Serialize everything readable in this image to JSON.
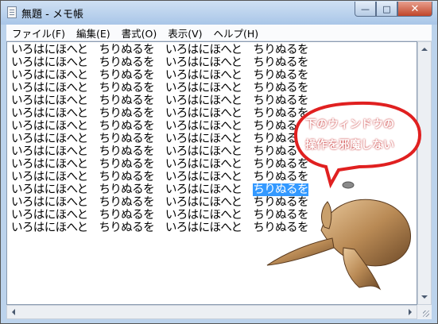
{
  "window": {
    "title": "無題 - メモ帳",
    "minimize_glyph": "—",
    "maximize_glyph": "□",
    "close_glyph": "✕",
    "icon": "notepad-icon"
  },
  "menu": {
    "items": [
      {
        "label": "ファイル(F)"
      },
      {
        "label": "編集(E)"
      },
      {
        "label": "書式(O)"
      },
      {
        "label": "表示(V)"
      },
      {
        "label": "ヘルプ(H)"
      }
    ]
  },
  "editor": {
    "lines": [
      "いろはにほへと　ちりぬるを　いろはにほへと　ちりぬるを",
      "いろはにほへと　ちりぬるを　いろはにほへと　ちりぬるを",
      "いろはにほへと　ちりぬるを　いろはにほへと　ちりぬるを",
      "いろはにほへと　ちりぬるを　いろはにほへと　ちりぬるを",
      "いろはにほへと　ちりぬるを　いろはにほへと　ちりぬるを",
      "いろはにほへと　ちりぬるを　いろはにほへと　ちりぬるを",
      "いろはにほへと　ちりぬるを　いろはにほへと　ちりぬるを",
      "いろはにほへと　ちりぬるを　いろはにほへと　ちりぬるを",
      "いろはにほへと　ちりぬるを　いろはにほへと　ちりぬるを",
      "いろはにほへと　ちりぬるを　いろはにほへと　ちりぬるを",
      "いろはにほへと　ちりぬるを　いろはにほへと　ちりぬるを",
      "いろはにほへと　ちりぬるを　いろはにほへと　ちりぬるを",
      "いろはにほへと　ちりぬるを　いろはにほへと　ちりぬるを",
      "いろはにほへと　ちりぬるを　いろはにほへと　ちりぬるを",
      "いろはにほへと　ちりぬるを　いろはにほへと　ちりぬるを"
    ],
    "selected_line_prefix": "いろはにほへと　ちりぬるを　いろはにほへと　",
    "selected_text": "ちりぬるを"
  },
  "overlay": {
    "bubble_line1": "下のウィンドウの",
    "bubble_line2": "操作を邪魔しない",
    "bubble_color": "#e02020",
    "character": "whale-mascot"
  },
  "colors": {
    "selection": "#3399ff",
    "close_button": "#c0452a",
    "frame": "#bcd3ec"
  }
}
